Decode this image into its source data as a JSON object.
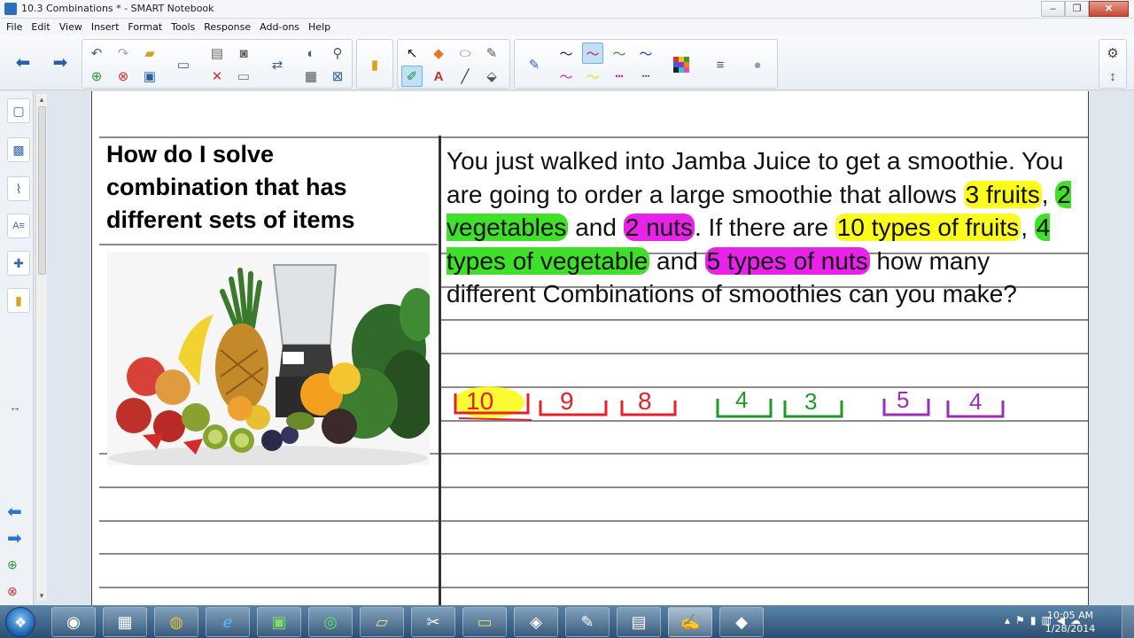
{
  "window": {
    "title": "10.3 Combinations * - SMART Notebook"
  },
  "menu": [
    "File",
    "Edit",
    "View",
    "Insert",
    "Format",
    "Tools",
    "Response",
    "Add-ons",
    "Help"
  ],
  "lesson": {
    "heading_lines": [
      "How do I solve",
      "combination that has",
      "different sets of items"
    ],
    "problem": {
      "p1": "You just walked into Jamba Juice to get a smoothie. You are going to order a large smoothie that allows ",
      "h1": "3 fruits",
      "p2": ", ",
      "h2": "2 vegetables",
      "p3": " and ",
      "h3": "2 nuts",
      "p4": ". If there are ",
      "h4": "10 types of fruits",
      "p5": ", ",
      "h5": "4 types of vegetable",
      "p6": " and ",
      "h6": "5 types of nuts",
      "p7": " how many different Combinations of smoothies can you make?"
    },
    "handwritten_numbers": [
      "10",
      "9",
      "8",
      "4",
      "3",
      "5",
      "4"
    ]
  },
  "taskbar": {
    "clock_time": "10:05 AM",
    "clock_date": "1/28/2014"
  },
  "colors": {
    "highlight_yellow": "#fbfb1c",
    "highlight_green": "#3fe029",
    "highlight_magenta": "#e822e8",
    "ink_red": "#e5202a",
    "ink_green": "#1f9a2a",
    "ink_purple": "#9b2fb8"
  }
}
